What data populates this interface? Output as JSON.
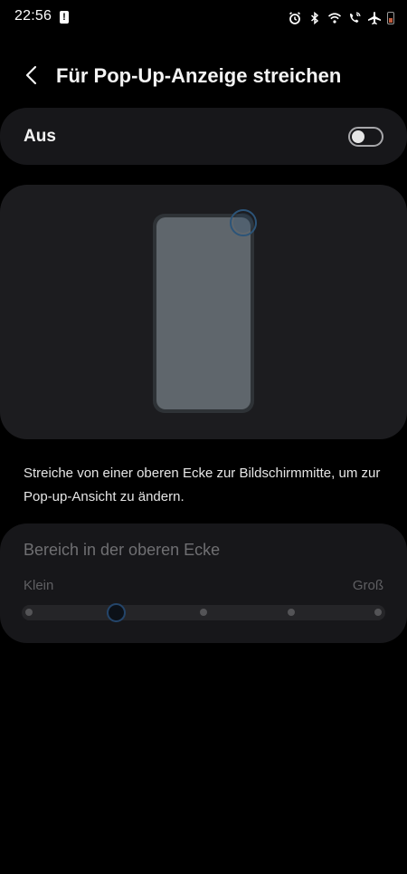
{
  "status_bar": {
    "time": "22:56",
    "icons": [
      "alert-icon",
      "alarm-icon",
      "bluetooth-icon",
      "wifi-icon",
      "wifi-calling-icon",
      "airplane-icon",
      "battery-icon"
    ]
  },
  "header": {
    "back_icon": "chevron-left-icon",
    "title": "Für Pop-Up-Anzeige streichen"
  },
  "toggle": {
    "label": "Aus",
    "enabled": false
  },
  "description": "Streiche von einer oberen Ecke zur Bildschirmmitte, um zur Pop-up-Ansicht zu ändern.",
  "area_slider": {
    "title": "Bereich in der oberen Ecke",
    "min_label": "Klein",
    "max_label": "Groß",
    "steps": 5,
    "selected_step": 2
  },
  "colors": {
    "background": "#000000",
    "card": "#17171a",
    "preview_phone": "#5f666c",
    "accent": "#24456a"
  }
}
